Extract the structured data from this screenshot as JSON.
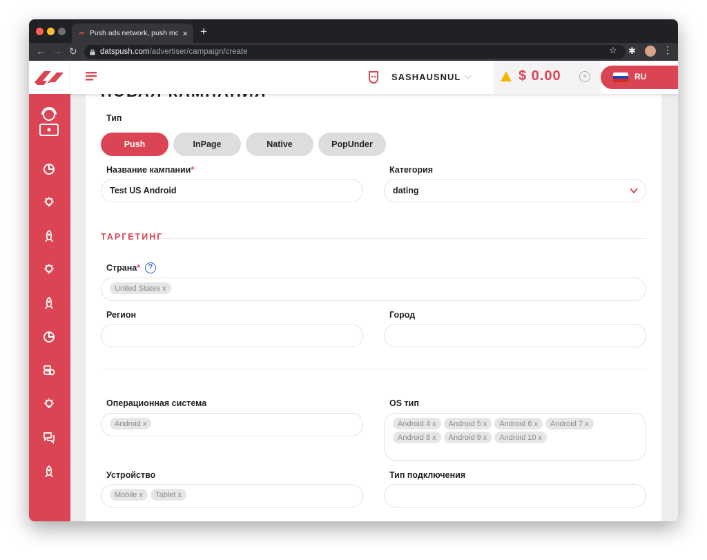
{
  "browser": {
    "tab_title": "Push ads network, push monet",
    "url_host": "datspush.com",
    "url_path": "/advertiser/campaign/create"
  },
  "header": {
    "username": "SASHAUSNUL",
    "balance": "$ 0.00",
    "language": "RU"
  },
  "page": {
    "title": "НОВАЯ КАМПАНИЯ"
  },
  "form": {
    "type_label": "Тип",
    "types": [
      "Push",
      "InPage",
      "Native",
      "PopUnder"
    ],
    "campaign_name_label": "Название кампании",
    "campaign_name_value": "Test US Android",
    "category_label": "Категория",
    "category_value": "dating",
    "targeting_title": "ТАРГЕТИНГ",
    "country_label": "Страна",
    "country_chips": [
      "United States x"
    ],
    "region_label": "Регион",
    "city_label": "Город",
    "os_label": "Операционная система",
    "os_chips": [
      "Android x"
    ],
    "os_type_label": "OS тип",
    "os_type_chips": [
      "Android 4 x",
      "Android 5 x",
      "Android 6 x",
      "Android 7 x",
      "Android 8 x",
      "Android 9 x",
      "Android 10 x"
    ],
    "device_label": "Устройство",
    "device_chips": [
      "Mobile x",
      "Tablet x"
    ],
    "connection_label": "Тип подключения",
    "required_mark": "*",
    "help_mark": "?"
  },
  "colors": {
    "brand": "#db4452",
    "sidebar": "#db4452",
    "help": "#2d5fa8"
  }
}
